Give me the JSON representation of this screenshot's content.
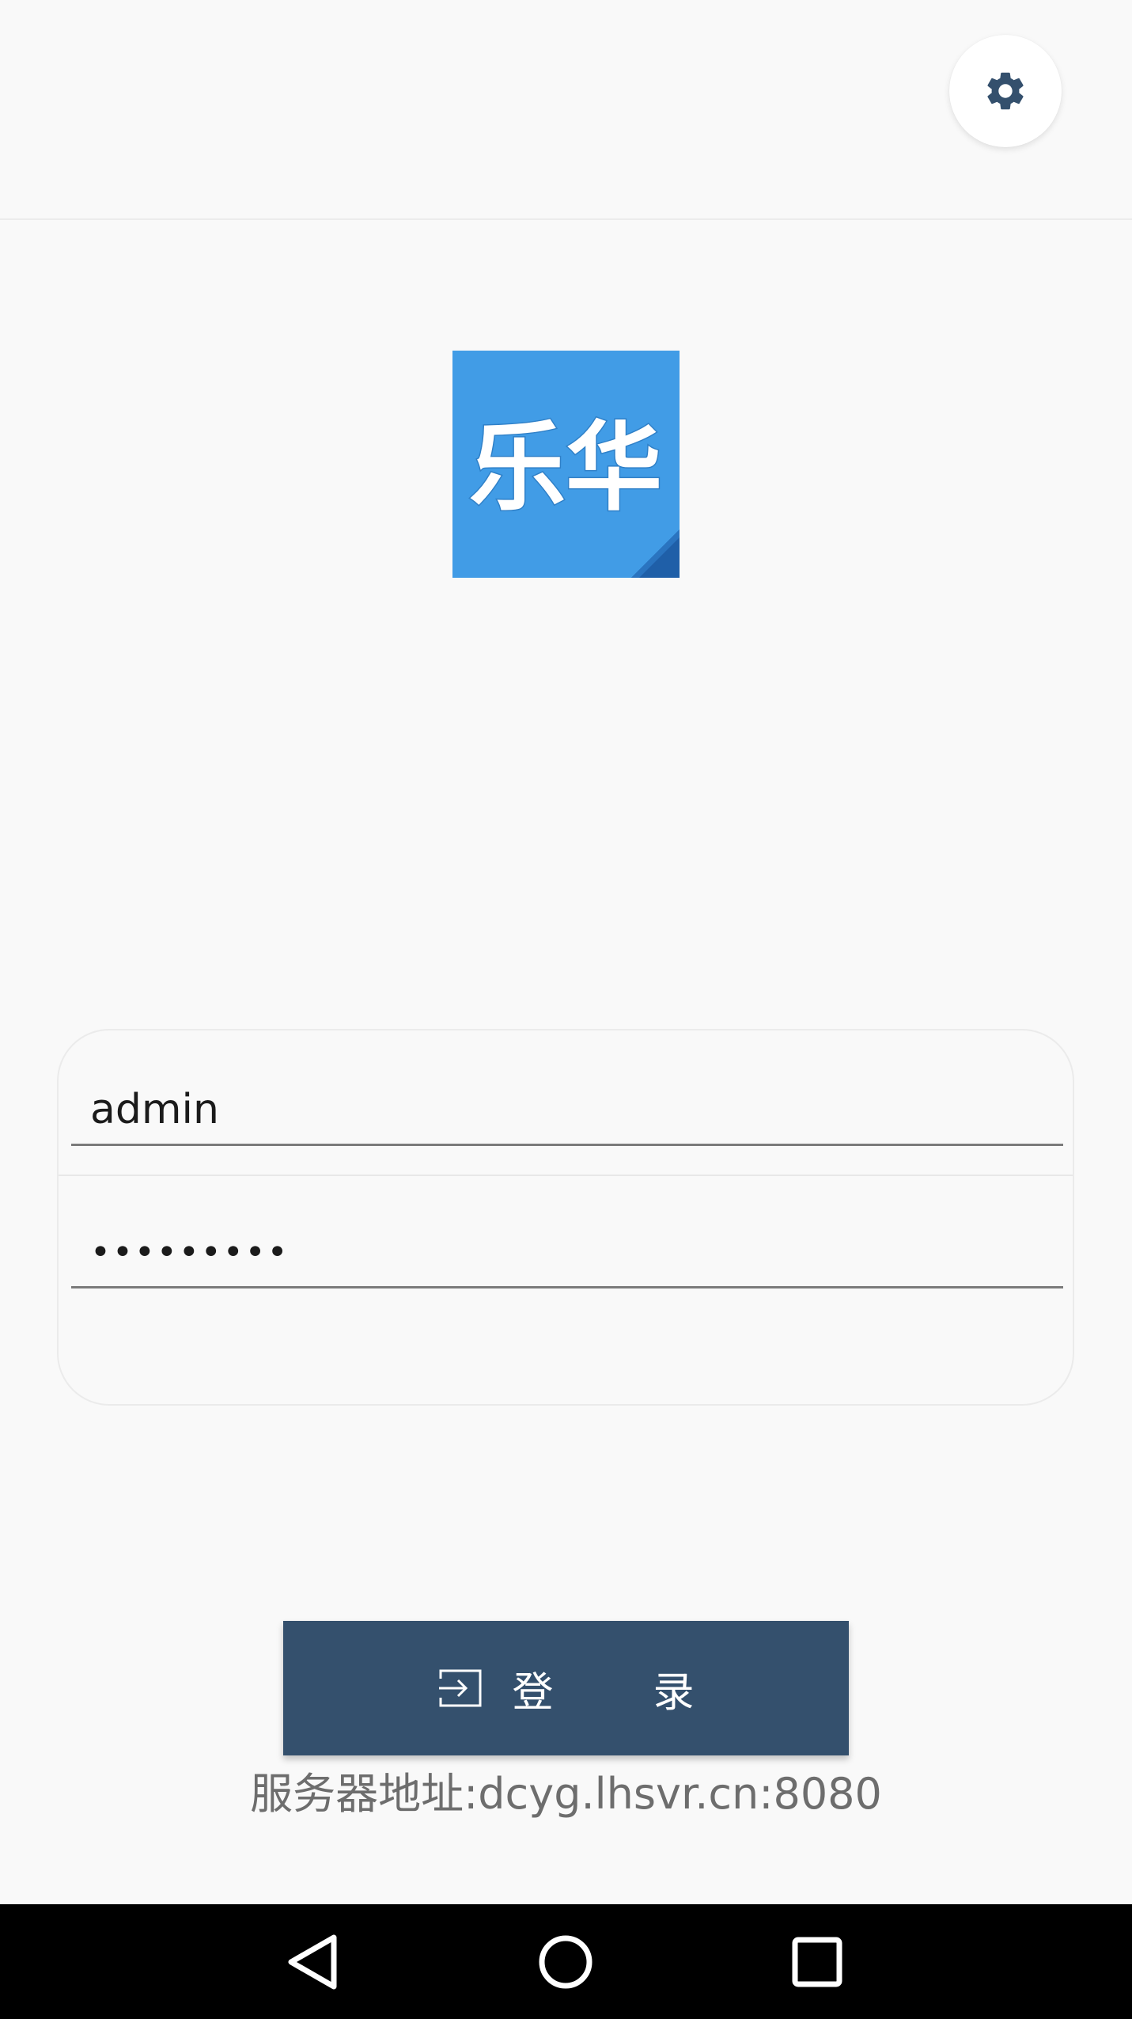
{
  "settings": {
    "icon": "gear-icon"
  },
  "logo": {
    "text": "乐华",
    "color": "#419ce6"
  },
  "login_form": {
    "username_value": "admin",
    "password_value": "•••••••••"
  },
  "login_button": {
    "label": "登录",
    "icon": "login-icon",
    "color": "#34506d"
  },
  "server": {
    "address_label": "服务器地址:dcyg.lhsvr.cn:8080"
  },
  "navigation": {
    "back_icon": "back-triangle-icon",
    "home_icon": "home-circle-icon",
    "recent_icon": "recent-apps-square-icon"
  }
}
